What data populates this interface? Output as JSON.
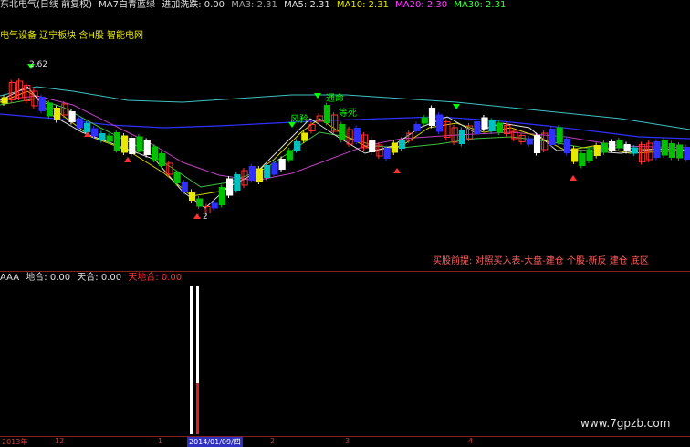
{
  "title_bar": {
    "stock": "东北电气(日线 前复权)",
    "indicator": "MA7白青蓝绿",
    "entry_label": "进加洗跌: 0.00",
    "ma3": "MA3: 2.31",
    "ma5": "MA5: 2.31",
    "ma10": "MA10: 2.31",
    "ma20": "MA20: 2.30",
    "ma30": "MA30: 2.31"
  },
  "concepts": "电气设备 辽宁板块 含H股 智能电网",
  "price_labels": {
    "high": "2.62",
    "low": "2"
  },
  "annotations": {
    "tongming": "通命",
    "fengxian": "风矜",
    "dengsi": "等死"
  },
  "buy_condition": "买股前提: 对照买入表-大盘-建仓  个股-新反 建仓 底区",
  "indicator_line": {
    "name": "AAA",
    "di_he": "地合: 0.00",
    "tian_he": "天合: 0.00",
    "tian_di_he": "天地合: 0.00"
  },
  "axis": {
    "year_label": "2013年",
    "month_12": "12",
    "month_1": "1",
    "date_cursor": "2014/01/09/四",
    "month_2": "2",
    "month_3": "3",
    "month_4": "4"
  },
  "watermark": "www.7gpzb.com",
  "colors": {
    "up": "#ff3030",
    "down": "#00e0e0",
    "green": "#00c000",
    "yellow": "#e8e800",
    "blue": "#3030ff",
    "white": "#ffffff",
    "bg": "#000000"
  }
}
